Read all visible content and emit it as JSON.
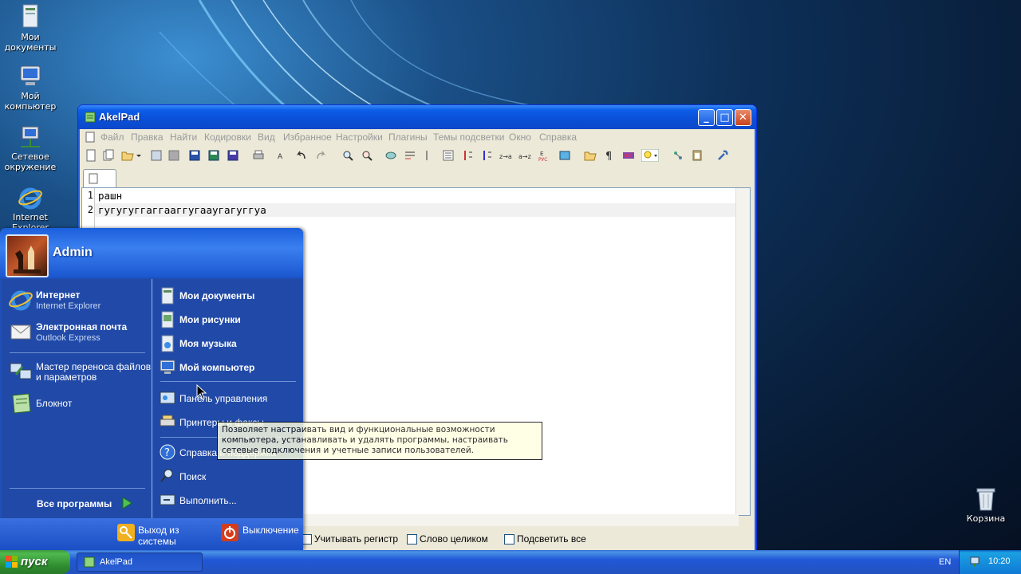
{
  "desktop": {
    "icons": [
      {
        "label": "Мои документы",
        "icon": "my-documents-icon"
      },
      {
        "label": "Мой компьютер",
        "icon": "my-computer-icon"
      },
      {
        "label": "Сетевое окружение",
        "icon": "network-icon"
      },
      {
        "label": "Internet Explorer",
        "icon": "ie-icon"
      },
      {
        "label": "Корзина",
        "icon": "recycle-bin-icon"
      }
    ]
  },
  "akelpad": {
    "title": "AkelPad",
    "menu": [
      "Файл",
      "Правка",
      "Найти",
      "Кодировки",
      "Вид",
      "Избранное",
      "Настройки",
      "Плагины",
      "Темы подсветки",
      "Окно",
      "Справка"
    ],
    "lines": [
      {
        "num": "1",
        "text": "рашн"
      },
      {
        "num": "2",
        "text": "гугугуггаггааггугааугагуггуа"
      }
    ],
    "find": {
      "case_label": "Учитывать регистр",
      "word_label": "Слово целиком",
      "highlight_label": "Подсветить все"
    }
  },
  "start_menu": {
    "user": "Admin",
    "pinned": [
      {
        "title": "Интернет",
        "subtitle": "Internet Explorer",
        "icon": "ie-icon"
      },
      {
        "title": "Электронная почта",
        "subtitle": "Outlook Express",
        "icon": "mail-icon"
      }
    ],
    "recent": [
      {
        "title": "Мастер переноса файлов и параметров",
        "icon": "transfer-wizard-icon"
      },
      {
        "title": "Блокнот",
        "icon": "notepad-icon"
      }
    ],
    "all_programs": "Все программы",
    "places": [
      {
        "title": "Мои документы",
        "bold": true
      },
      {
        "title": "Мои рисунки",
        "bold": true
      },
      {
        "title": "Моя музыка",
        "bold": true
      },
      {
        "title": "Мой компьютер",
        "bold": true
      },
      {
        "title": "Панель управления",
        "bold": false
      },
      {
        "title": "Принтеры и факсы",
        "bold": false
      },
      {
        "title": "Справка и поддержка",
        "bold": false
      },
      {
        "title": "Поиск",
        "bold": false
      },
      {
        "title": "Выполнить...",
        "bold": false
      }
    ],
    "logoff": "Выход из системы",
    "shutdown": "Выключение"
  },
  "tooltip": {
    "text": "Позволяет настраивать вид и функциональные возможности компьютера, устанавливать и удалять программы, настраивать сетевые подключения и учетные записи пользователей."
  },
  "taskbar": {
    "start": "пуск",
    "task": "AkelPad",
    "lang": "EN",
    "clock": "10:20"
  },
  "colors": {
    "start_green": "#3c9a3c",
    "taskbar_blue": "#2157d7",
    "titlebar_blue": "#0a4fd7"
  }
}
